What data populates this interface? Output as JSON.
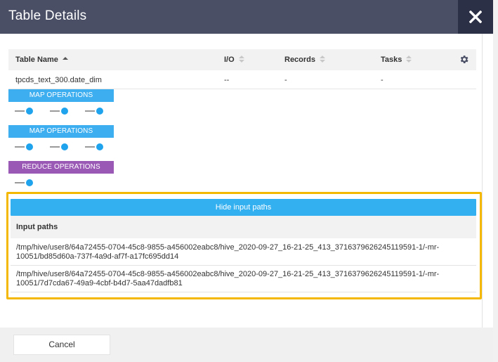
{
  "dialog": {
    "title": "Table Details",
    "close_icon": "close-icon"
  },
  "table": {
    "columns": [
      {
        "label": "Table Name",
        "sort": "ascending"
      },
      {
        "label": "I/O",
        "sort": "none"
      },
      {
        "label": "Records",
        "sort": "none"
      },
      {
        "label": "Tasks",
        "sort": "none"
      }
    ],
    "settings_icon": "gear-icon",
    "rows": [
      {
        "name": "tpcds_text_300.date_dim",
        "io": "--",
        "records": "-",
        "tasks": "-"
      }
    ]
  },
  "operations": [
    {
      "label": "MAP OPERATIONS",
      "type": "map",
      "color": "#3daeef",
      "nodes": 3
    },
    {
      "label": "MAP OPERATIONS",
      "type": "map",
      "color": "#3daeef",
      "nodes": 3
    },
    {
      "label": "REDUCE OPERATIONS",
      "type": "reduce",
      "color": "#9b59b6",
      "nodes": 1
    }
  ],
  "input_paths": {
    "toggle_label": "Hide input paths",
    "header": "Input paths",
    "paths": [
      "/tmp/hive/user8/64a72455-0704-45c8-9855-a456002eabc8/hive_2020-09-27_16-21-25_413_3716379626245119591-1/-mr-10051/bd85d60a-737f-4a9d-af7f-a17fc695dd14",
      "/tmp/hive/user8/64a72455-0704-45c8-9855-a456002eabc8/hive_2020-09-27_16-21-25_413_3716379626245119591-1/-mr-10051/7d7cda67-49a9-4cbf-b4d7-5aa47dadfb81"
    ],
    "highlight_color": "#f5b800"
  },
  "footer": {
    "cancel_label": "Cancel"
  }
}
